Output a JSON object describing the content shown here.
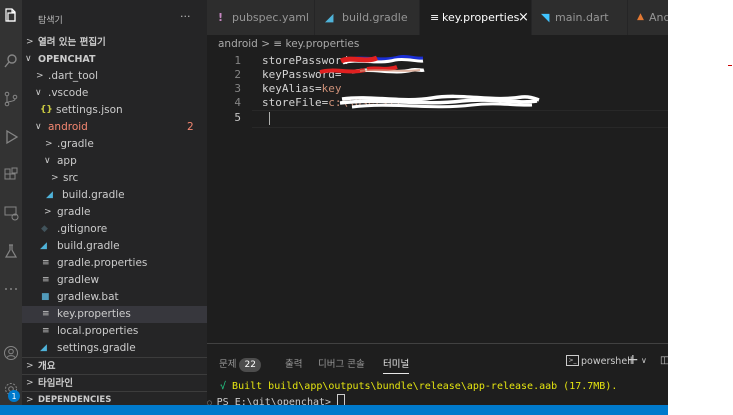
{
  "sidebar": {
    "title": "탐색기",
    "more": "···",
    "sections": {
      "open_editors": "열려 있는 편집기",
      "project": "OPENCHAT",
      "outline": "개요",
      "timeline": "타임라인",
      "dependencies": "DEPENDENCIES"
    },
    "items": [
      {
        "label": ".dart_tool"
      },
      {
        "label": ".vscode"
      },
      {
        "label": "settings.json"
      },
      {
        "label": "android",
        "badge": "2"
      },
      {
        "label": ".gradle"
      },
      {
        "label": "app"
      },
      {
        "label": "src"
      },
      {
        "label": "build.gradle"
      },
      {
        "label": "gradle"
      },
      {
        "label": ".gitignore"
      },
      {
        "label": "build.gradle"
      },
      {
        "label": "gradle.properties"
      },
      {
        "label": "gradlew"
      },
      {
        "label": "gradlew.bat"
      },
      {
        "label": "key.properties"
      },
      {
        "label": "local.properties"
      },
      {
        "label": "settings.gradle"
      }
    ]
  },
  "tabs": [
    {
      "label": "pubspec.yaml",
      "icon": "!"
    },
    {
      "label": "build.gradle",
      "icon": "gradle"
    },
    {
      "label": "key.properties",
      "icon": "≡",
      "close": "×"
    },
    {
      "label": "main.dart",
      "icon": "dart"
    },
    {
      "label": "Andr",
      "icon": "android"
    }
  ],
  "breadcrumb": {
    "folder": "android",
    "sep": ">",
    "file_icon": "≡",
    "file": "key.properties"
  },
  "code": {
    "line_numbers": [
      "1",
      "2",
      "3",
      "4",
      "5"
    ],
    "lines": [
      {
        "key": "storePassword=",
        "val": ""
      },
      {
        "key": "keyPassword=",
        "val": ""
      },
      {
        "key": "keyAlias=",
        "val": "key"
      },
      {
        "key": "storeFile=",
        "val": "c:\\\\Users\\\\"
      },
      {
        "key": "",
        "val": ""
      }
    ]
  },
  "panel": {
    "tabs": [
      "문제",
      "출력",
      "디버그 콘솔",
      "터미널"
    ],
    "problem_count": "22",
    "shell": "powershell",
    "plus": "+",
    "term_line1_check": "√",
    "term_line1": " Built build\\app\\outputs\\bundle\\release\\app-release.aab (17.7MB).",
    "term_prompt": "PS E:\\git\\openchat> "
  },
  "activity_badge": "1",
  "colors": {
    "accent": "#007acc",
    "error": "#f48771",
    "string": "#ce9178"
  }
}
